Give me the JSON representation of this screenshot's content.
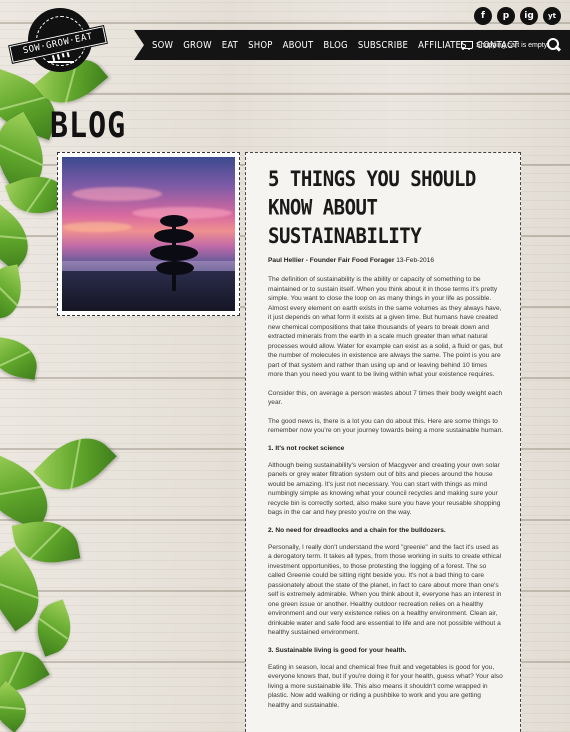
{
  "logo": {
    "text": "SOW·GROW·EAT"
  },
  "social": [
    "f",
    "p",
    "ig",
    "yt"
  ],
  "nav": {
    "links": [
      "SOW",
      "GROW",
      "EAT",
      "SHOP",
      "ABOUT",
      "BLOG",
      "SUBSCRIBE",
      "AFFILIATES",
      "CONTACT"
    ],
    "cart_text": "Shopping cart is empty."
  },
  "page": {
    "heading": "BLOG"
  },
  "article": {
    "title": "5 THINGS YOU SHOULD KNOW ABOUT SUSTAINABILITY",
    "author": "Paul Hellier - Founder Fair Food Forager",
    "date": "13-Feb-2016",
    "p1": "The definition of sustainability is the ability or capacity of something to be maintained or to sustain itself. When you think about it in those terms it's pretty simple. You want to close the loop on as many things in your life as possible. Almost every element on earth exists in the same volumes as they always have, it just depends on what form it exists at a given time. But humans have created new chemical compositions that take thousands of years to break down and extracted minerals from the earth in a scale much greater than what natural processes would allow. Water for example can exist as a solid, a fluid or gas, but the number of molecules in existence are always the same. The point is you are part of that system and rather than using up and or leaving behind 10 times more than you need you want to be living within what your existence requires.",
    "p2": "Consider this, on average a person wastes about 7 times their body weight each year.",
    "p3": "The good news is, there is a lot you can do about this. Here are some things to remember now you're on your journey towards being a more sustainable human.",
    "h1": "1. It's not rocket science",
    "p4": "Although being sustainability's version of Macgyver and creating your own solar panels or grey water filtration system out of bits and pieces around the house would be amazing. It's just not necessary. You can start with things as mind numbingly simple as knowing what your council recycles and making sure your recycle bin is correctly sorted, also make sure you have your reusable shopping bags in the car and hey presto you're on the way.",
    "h2": "2. No need for dreadlocks and a chain for the bulldozers.",
    "p5": "Personally, I really don't understand the word \"greenie\" and the fact it's used as a derogatory term. It takes all types, from those working in suits to create ethical investment opportunities, to those protesting the logging of a forest. The so called Greenie could be sitting right beside you. It's not a bad thing to care passionately about the state of the planet, in fact to care about more than one's self is extremely admirable. When you think about it, everyone has an interest in one green issue or another. Healthy outdoor recreation relies on a healthy environment and our very existence relies on a healthy environment. Clean air, drinkable water and safe food are essential to life and are not possible without a healthy sustained environment.",
    "h3": "3. Sustainable living is good for your health.",
    "p6": "Eating in season, local and chemical free fruit and vegetables is good for you, everyone knows that, but if you're doing it for your health, guess what? Your also living a more sustainable life. This also means it shouldn't come wrapped in plastic. Now add walking or riding a pushbike to work and you are getting healthy and sustainable."
  }
}
